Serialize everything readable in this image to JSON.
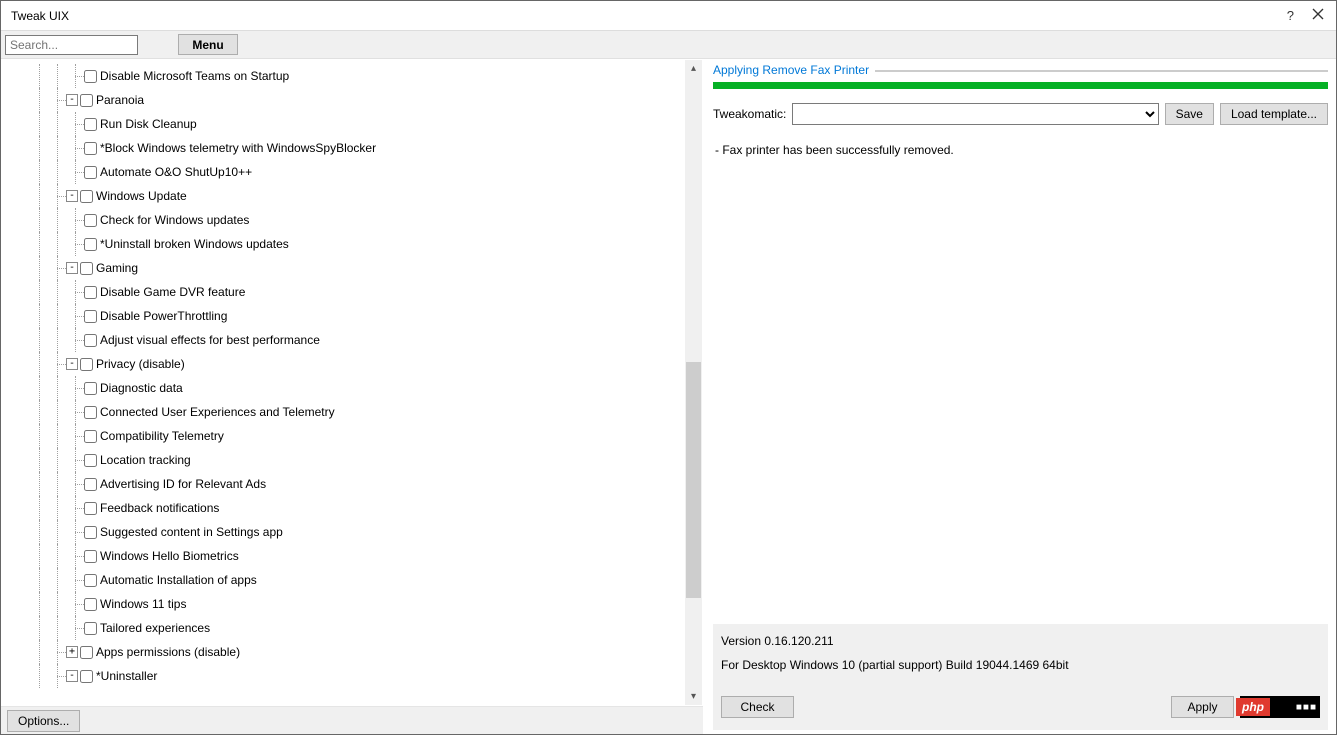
{
  "window": {
    "title": "Tweak UIX"
  },
  "toolbar": {
    "search_placeholder": "Search...",
    "menu_label": "Menu"
  },
  "tree": [
    {
      "level": 2,
      "hasExp": false,
      "label": "Disable Microsoft Teams on Startup"
    },
    {
      "level": 1,
      "hasExp": true,
      "exp": "-",
      "label": "Paranoia"
    },
    {
      "level": 2,
      "hasExp": false,
      "label": "Run Disk Cleanup"
    },
    {
      "level": 2,
      "hasExp": false,
      "label": "*Block Windows telemetry with WindowsSpyBlocker"
    },
    {
      "level": 2,
      "hasExp": false,
      "label": "Automate O&O ShutUp10++"
    },
    {
      "level": 1,
      "hasExp": true,
      "exp": "-",
      "label": "Windows Update"
    },
    {
      "level": 2,
      "hasExp": false,
      "label": "Check for Windows updates"
    },
    {
      "level": 2,
      "hasExp": false,
      "label": "*Uninstall broken Windows updates"
    },
    {
      "level": 1,
      "hasExp": true,
      "exp": "-",
      "label": "Gaming"
    },
    {
      "level": 2,
      "hasExp": false,
      "label": "Disable Game DVR feature"
    },
    {
      "level": 2,
      "hasExp": false,
      "label": "Disable PowerThrottling"
    },
    {
      "level": 2,
      "hasExp": false,
      "label": "Adjust visual effects for best performance"
    },
    {
      "level": 1,
      "hasExp": true,
      "exp": "-",
      "label": "Privacy (disable)"
    },
    {
      "level": 2,
      "hasExp": false,
      "label": "Diagnostic data"
    },
    {
      "level": 2,
      "hasExp": false,
      "label": "Connected User Experiences and Telemetry"
    },
    {
      "level": 2,
      "hasExp": false,
      "label": "Compatibility Telemetry"
    },
    {
      "level": 2,
      "hasExp": false,
      "label": "Location tracking"
    },
    {
      "level": 2,
      "hasExp": false,
      "label": "Advertising ID for Relevant Ads"
    },
    {
      "level": 2,
      "hasExp": false,
      "label": "Feedback notifications"
    },
    {
      "level": 2,
      "hasExp": false,
      "label": "Suggested content in Settings app"
    },
    {
      "level": 2,
      "hasExp": false,
      "label": "Windows Hello Biometrics"
    },
    {
      "level": 2,
      "hasExp": false,
      "label": "Automatic Installation of apps"
    },
    {
      "level": 2,
      "hasExp": false,
      "label": "Windows 11 tips"
    },
    {
      "level": 2,
      "hasExp": false,
      "label": "Tailored experiences"
    },
    {
      "level": 1,
      "hasExp": true,
      "exp": "+",
      "label": "Apps permissions (disable)"
    },
    {
      "level": 1,
      "hasExp": true,
      "exp": "-",
      "labelPrefix": "*",
      "label": "*Uninstaller",
      "cut": true
    }
  ],
  "options": {
    "label": "Options..."
  },
  "right": {
    "group_title": "Applying Remove Fax Printer",
    "tweak_label": "Tweakomatic:",
    "save_label": "Save",
    "load_label": "Load template...",
    "log_line": "- Fax printer has been successfully removed."
  },
  "status": {
    "version": "Version 0.16.120.211",
    "platform": "For Desktop Windows 10 (partial support) Build 19044.1469 64bit",
    "check_label": "Check",
    "apply_label": "Apply"
  },
  "watermark": {
    "left": "php",
    "right": "■■■"
  }
}
